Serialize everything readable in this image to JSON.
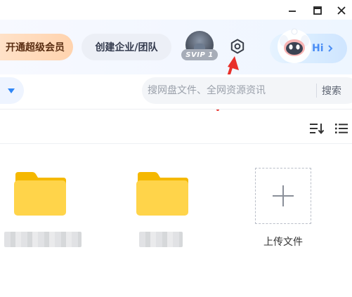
{
  "window_controls": {
    "minimize_icon": "minimize-icon",
    "maximize_icon": "maximize-icon",
    "close_icon": "close-icon"
  },
  "header": {
    "vip_button_label": "开通超级会员",
    "team_button_label": "创建企业/团队",
    "badge_text": "SVIP 1",
    "ai_greeting": "Hi",
    "colors": {
      "vip_bg": "#ffd9b8",
      "accent": "#4a8df5",
      "arrow": "#e8302a"
    }
  },
  "toolbar": {
    "search_placeholder": "搜网盘文件、全网资源资讯",
    "search_button_label": "搜索"
  },
  "files": {
    "items": [
      {
        "type": "folder",
        "name_visible": false
      },
      {
        "type": "folder",
        "name_visible": false
      }
    ],
    "upload_label": "上传文件"
  }
}
